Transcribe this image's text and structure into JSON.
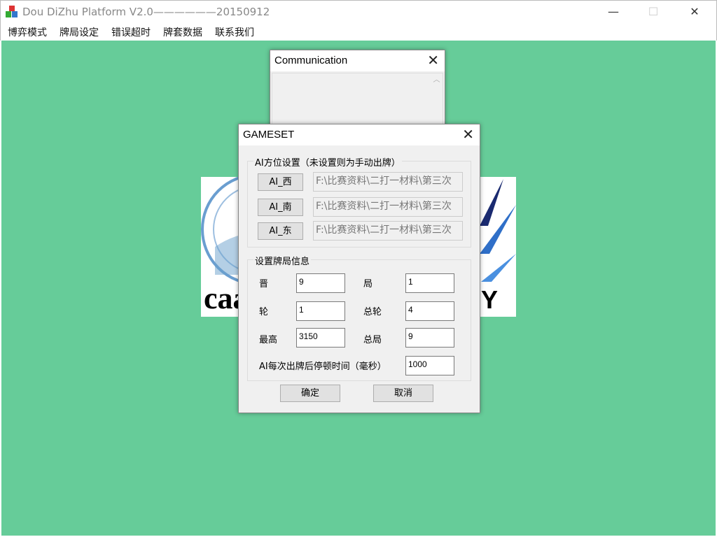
{
  "window": {
    "title": "Dou DiZhu Platform V2.0——————20150912",
    "minimize": "—",
    "maximize": "☐",
    "close": "✕"
  },
  "menu": [
    "博弈模式",
    "牌局设定",
    "错误超时",
    "牌套数据",
    "联系我们"
  ],
  "logo": {
    "left_text": "caa",
    "right_text": "IY"
  },
  "communication": {
    "title": "Communication",
    "close": "✕"
  },
  "gameset": {
    "title": "GAMESET",
    "close": "✕",
    "ai_group": {
      "label": "AI方位设置（未设置则为手动出牌）",
      "rows": [
        {
          "button": "AI_西",
          "path": "F:\\比赛资料\\二打一材料\\第三次"
        },
        {
          "button": "AI_南",
          "path": "F:\\比赛资料\\二打一材料\\第三次"
        },
        {
          "button": "AI_东",
          "path": "F:\\比赛资料\\二打一材料\\第三次"
        }
      ]
    },
    "info_group": {
      "label": "设置牌局信息",
      "fields": [
        {
          "label": "晋",
          "value": "9"
        },
        {
          "label": "局",
          "value": "1"
        },
        {
          "label": "轮",
          "value": "1"
        },
        {
          "label": "总轮",
          "value": "4"
        },
        {
          "label": "最高",
          "value": "3150"
        },
        {
          "label": "总局",
          "value": "9"
        }
      ],
      "delay": {
        "label": "AI每次出牌后停顿时间（毫秒）",
        "value": "1000"
      }
    },
    "ok": "确定",
    "cancel": "取消"
  },
  "colors": {
    "background": "#66cc99"
  }
}
